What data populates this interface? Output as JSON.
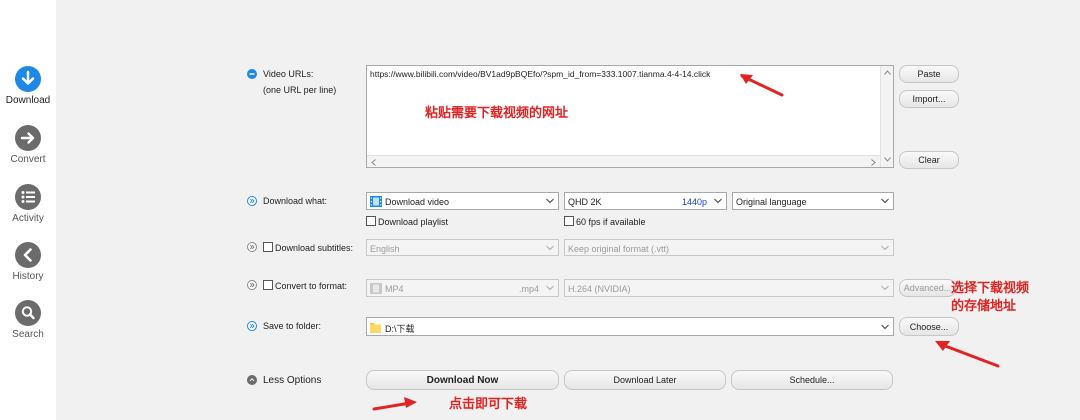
{
  "sidebar": {
    "items": [
      {
        "label": "Download",
        "icon": "download-icon"
      },
      {
        "label": "Convert",
        "icon": "convert-icon"
      },
      {
        "label": "Activity",
        "icon": "activity-icon"
      },
      {
        "label": "History",
        "icon": "history-icon"
      },
      {
        "label": "Search",
        "icon": "search-icon"
      }
    ]
  },
  "urls": {
    "label": "Video URLs:",
    "sublabel": "(one URL per line)",
    "value": "https://www.bilibili.com/video/BV1ad9pBQEfo/?spm_id_from=333.1007.tianma.4-4-14.click",
    "paste_label": "Paste",
    "import_label": "Import...",
    "clear_label": "Clear"
  },
  "download_what": {
    "label": "Download what:",
    "type_value": "Download video",
    "quality_value": "QHD 2K",
    "quality_res": "1440p",
    "language_value": "Original language",
    "playlist_label": "Download playlist",
    "fps_label": "60 fps if available"
  },
  "subtitles": {
    "label": "Download subtitles:",
    "language_value": "English",
    "format_value": "Keep original format (.vtt)"
  },
  "convert": {
    "label": "Convert to format:",
    "format_value": "MP4",
    "format_ext": ".mp4",
    "codec_value": "H.264 (NVIDIA)",
    "advanced_label": "Advanced..."
  },
  "save": {
    "label": "Save to folder:",
    "folder_value": "D:\\下载",
    "choose_label": "Choose..."
  },
  "footer": {
    "less_options_label": "Less Options",
    "download_now_label": "Download Now",
    "download_later_label": "Download Later",
    "schedule_label": "Schedule..."
  },
  "annotations": {
    "paste_hint": "粘贴需要下载视频的网址",
    "folder_hint_line1": "选择下载视频",
    "folder_hint_line2": "的存储地址",
    "download_hint": "点击即可下载"
  },
  "colors": {
    "accent": "#1e88e5",
    "annotation": "#e02424",
    "sidebar_icon": "#6b6b6b"
  }
}
